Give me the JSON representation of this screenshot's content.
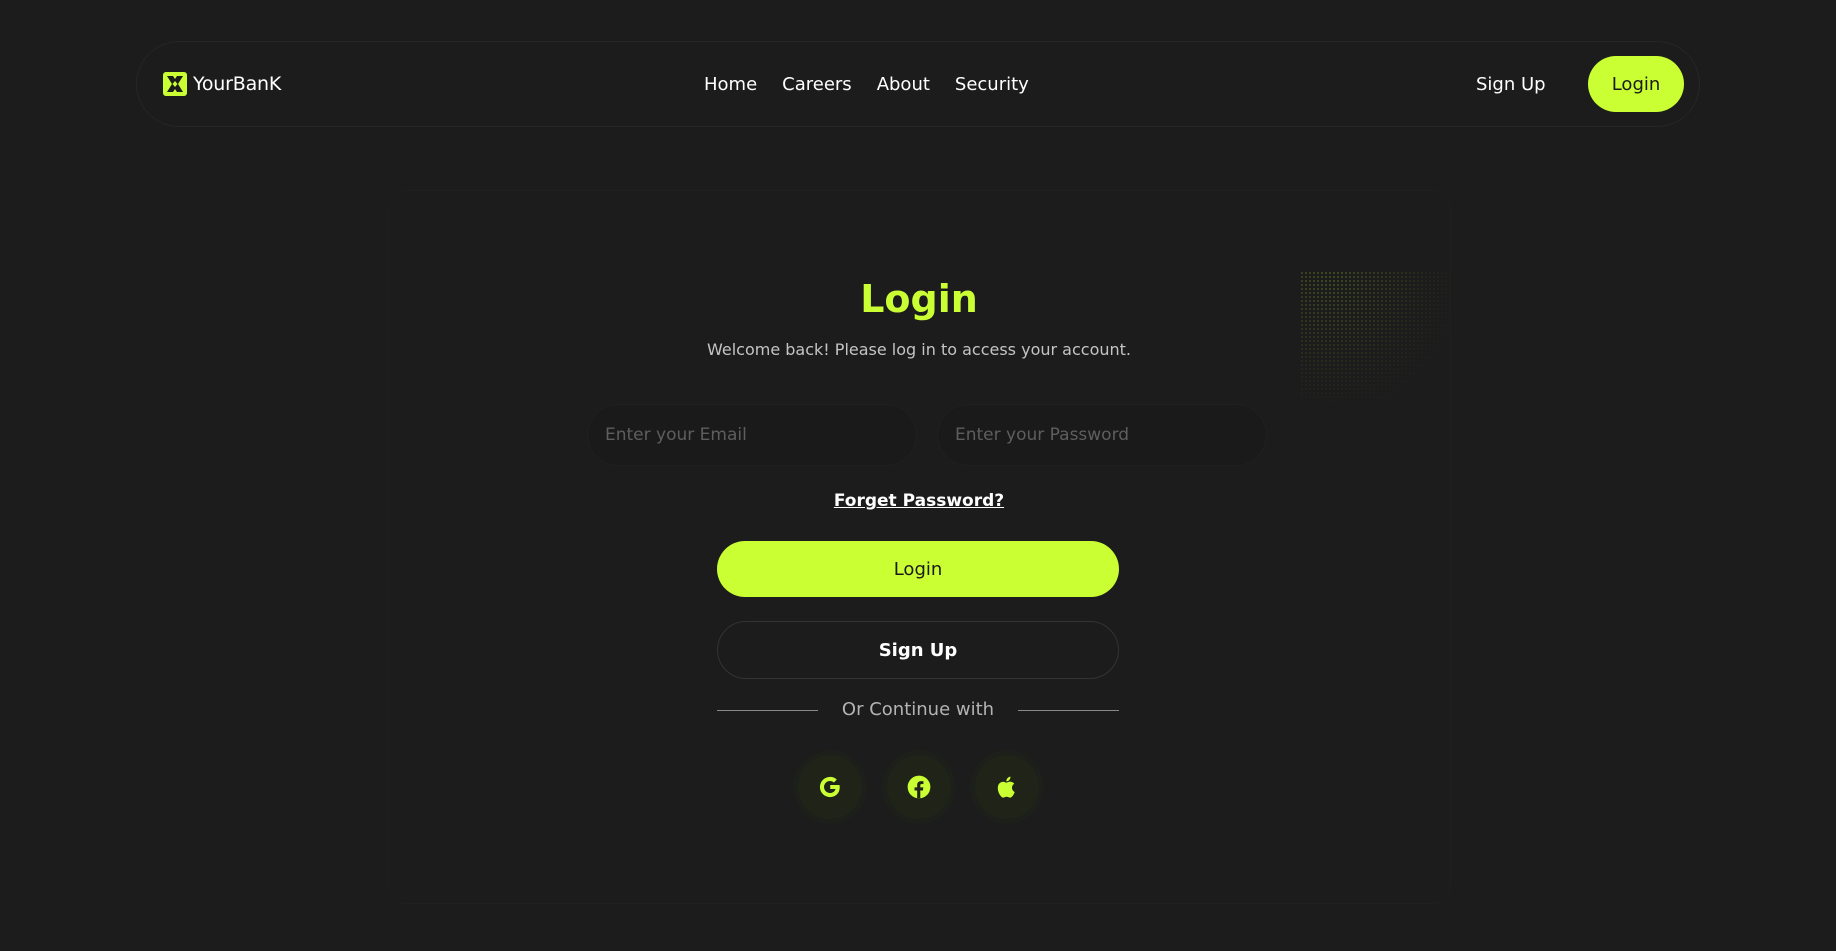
{
  "brand": {
    "name": "YourBanK",
    "logo_icon": "yourbank-logo-icon"
  },
  "nav": {
    "links": [
      {
        "label": "Home"
      },
      {
        "label": "Careers"
      },
      {
        "label": "About"
      },
      {
        "label": "Security"
      }
    ],
    "signup_label": "Sign Up",
    "login_label": "Login"
  },
  "login_form": {
    "title": "Login",
    "subtitle": "Welcome back! Please log in to access your account.",
    "email_placeholder": "Enter your Email",
    "email_value": "",
    "password_placeholder": "Enter your Password",
    "password_value": "",
    "forget_password_label": "Forget Password?",
    "login_button_label": "Login",
    "signup_button_label": "Sign Up",
    "continue_with_label": "Or Continue with",
    "social_icons": [
      "google-icon",
      "facebook-icon",
      "apple-icon"
    ]
  },
  "colors": {
    "accent": "#caff33",
    "background": "#1c1c1c",
    "text": "#ffffff",
    "muted_text": "#b3b3b3"
  }
}
